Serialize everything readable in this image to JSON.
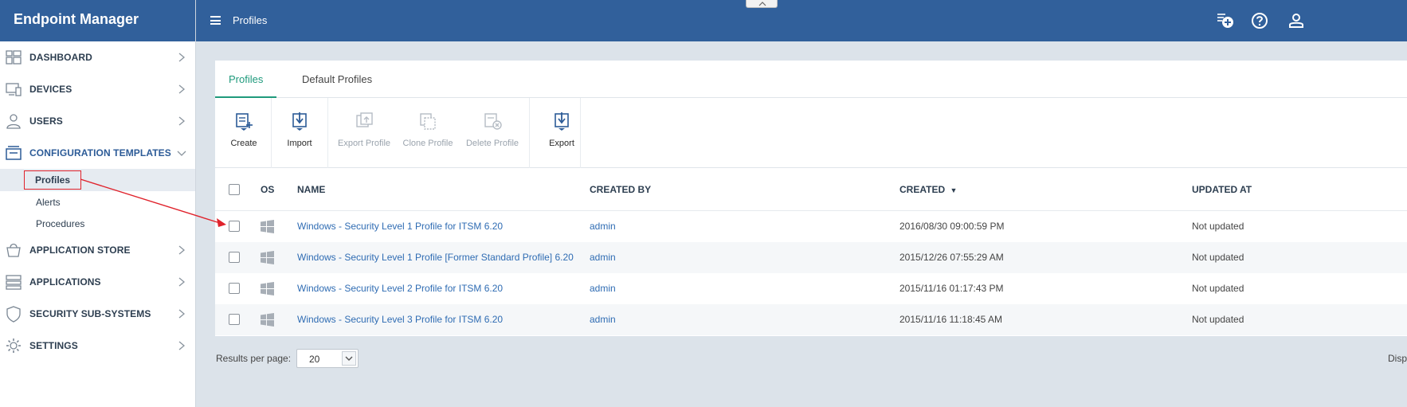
{
  "app": {
    "title": "Endpoint Manager"
  },
  "header": {
    "page_title": "Profiles",
    "icons": [
      "add-notification-icon",
      "help-icon",
      "user-icon"
    ]
  },
  "sidebar": {
    "items": [
      {
        "label": "DASHBOARD",
        "icon": "dashboard-icon"
      },
      {
        "label": "DEVICES",
        "icon": "devices-icon"
      },
      {
        "label": "USERS",
        "icon": "users-icon"
      },
      {
        "label": "CONFIGURATION TEMPLATES",
        "icon": "templates-icon",
        "expanded": true
      },
      {
        "label": "APPLICATION STORE",
        "icon": "store-icon"
      },
      {
        "label": "APPLICATIONS",
        "icon": "applications-icon"
      },
      {
        "label": "SECURITY SUB-SYSTEMS",
        "icon": "shield-icon"
      },
      {
        "label": "SETTINGS",
        "icon": "gear-icon"
      }
    ],
    "sub_items": [
      {
        "label": "Profiles",
        "selected": true
      },
      {
        "label": "Alerts"
      },
      {
        "label": "Procedures"
      }
    ]
  },
  "tabs": [
    {
      "label": "Profiles",
      "active": true
    },
    {
      "label": "Default Profiles"
    }
  ],
  "toolbar": {
    "create": "Create",
    "import": "Import",
    "export_profile": "Export Profile",
    "clone_profile": "Clone Profile",
    "delete_profile": "Delete Profile",
    "export": "Export"
  },
  "table": {
    "columns": {
      "os": "OS",
      "name": "NAME",
      "created_by": "CREATED BY",
      "created": "CREATED",
      "updated_at": "UPDATED AT"
    },
    "sort_indicator": "▼",
    "rows": [
      {
        "name": "Windows - Security Level 1 Profile for ITSM 6.20",
        "created_by": "admin",
        "created": "2016/08/30 09:00:59 PM",
        "updated_at": "Not updated"
      },
      {
        "name": "Windows - Security Level 1 Profile [Former Standard Profile] 6.20",
        "created_by": "admin",
        "created": "2015/12/26 07:55:29 AM",
        "updated_at": "Not updated"
      },
      {
        "name": "Windows - Security Level 2 Profile for ITSM 6.20",
        "created_by": "admin",
        "created": "2015/11/16 01:17:43 PM",
        "updated_at": "Not updated"
      },
      {
        "name": "Windows - Security Level 3 Profile for ITSM 6.20",
        "created_by": "admin",
        "created": "2015/11/16 11:18:45 AM",
        "updated_at": "Not updated"
      }
    ]
  },
  "footer": {
    "results_label": "Results per page:",
    "per_page_value": "20",
    "display_text": "Disp"
  },
  "colors": {
    "brand": "#31609b",
    "accent": "#1f9a7c",
    "link": "#2f6cb3",
    "annotation": "#e0232c"
  }
}
